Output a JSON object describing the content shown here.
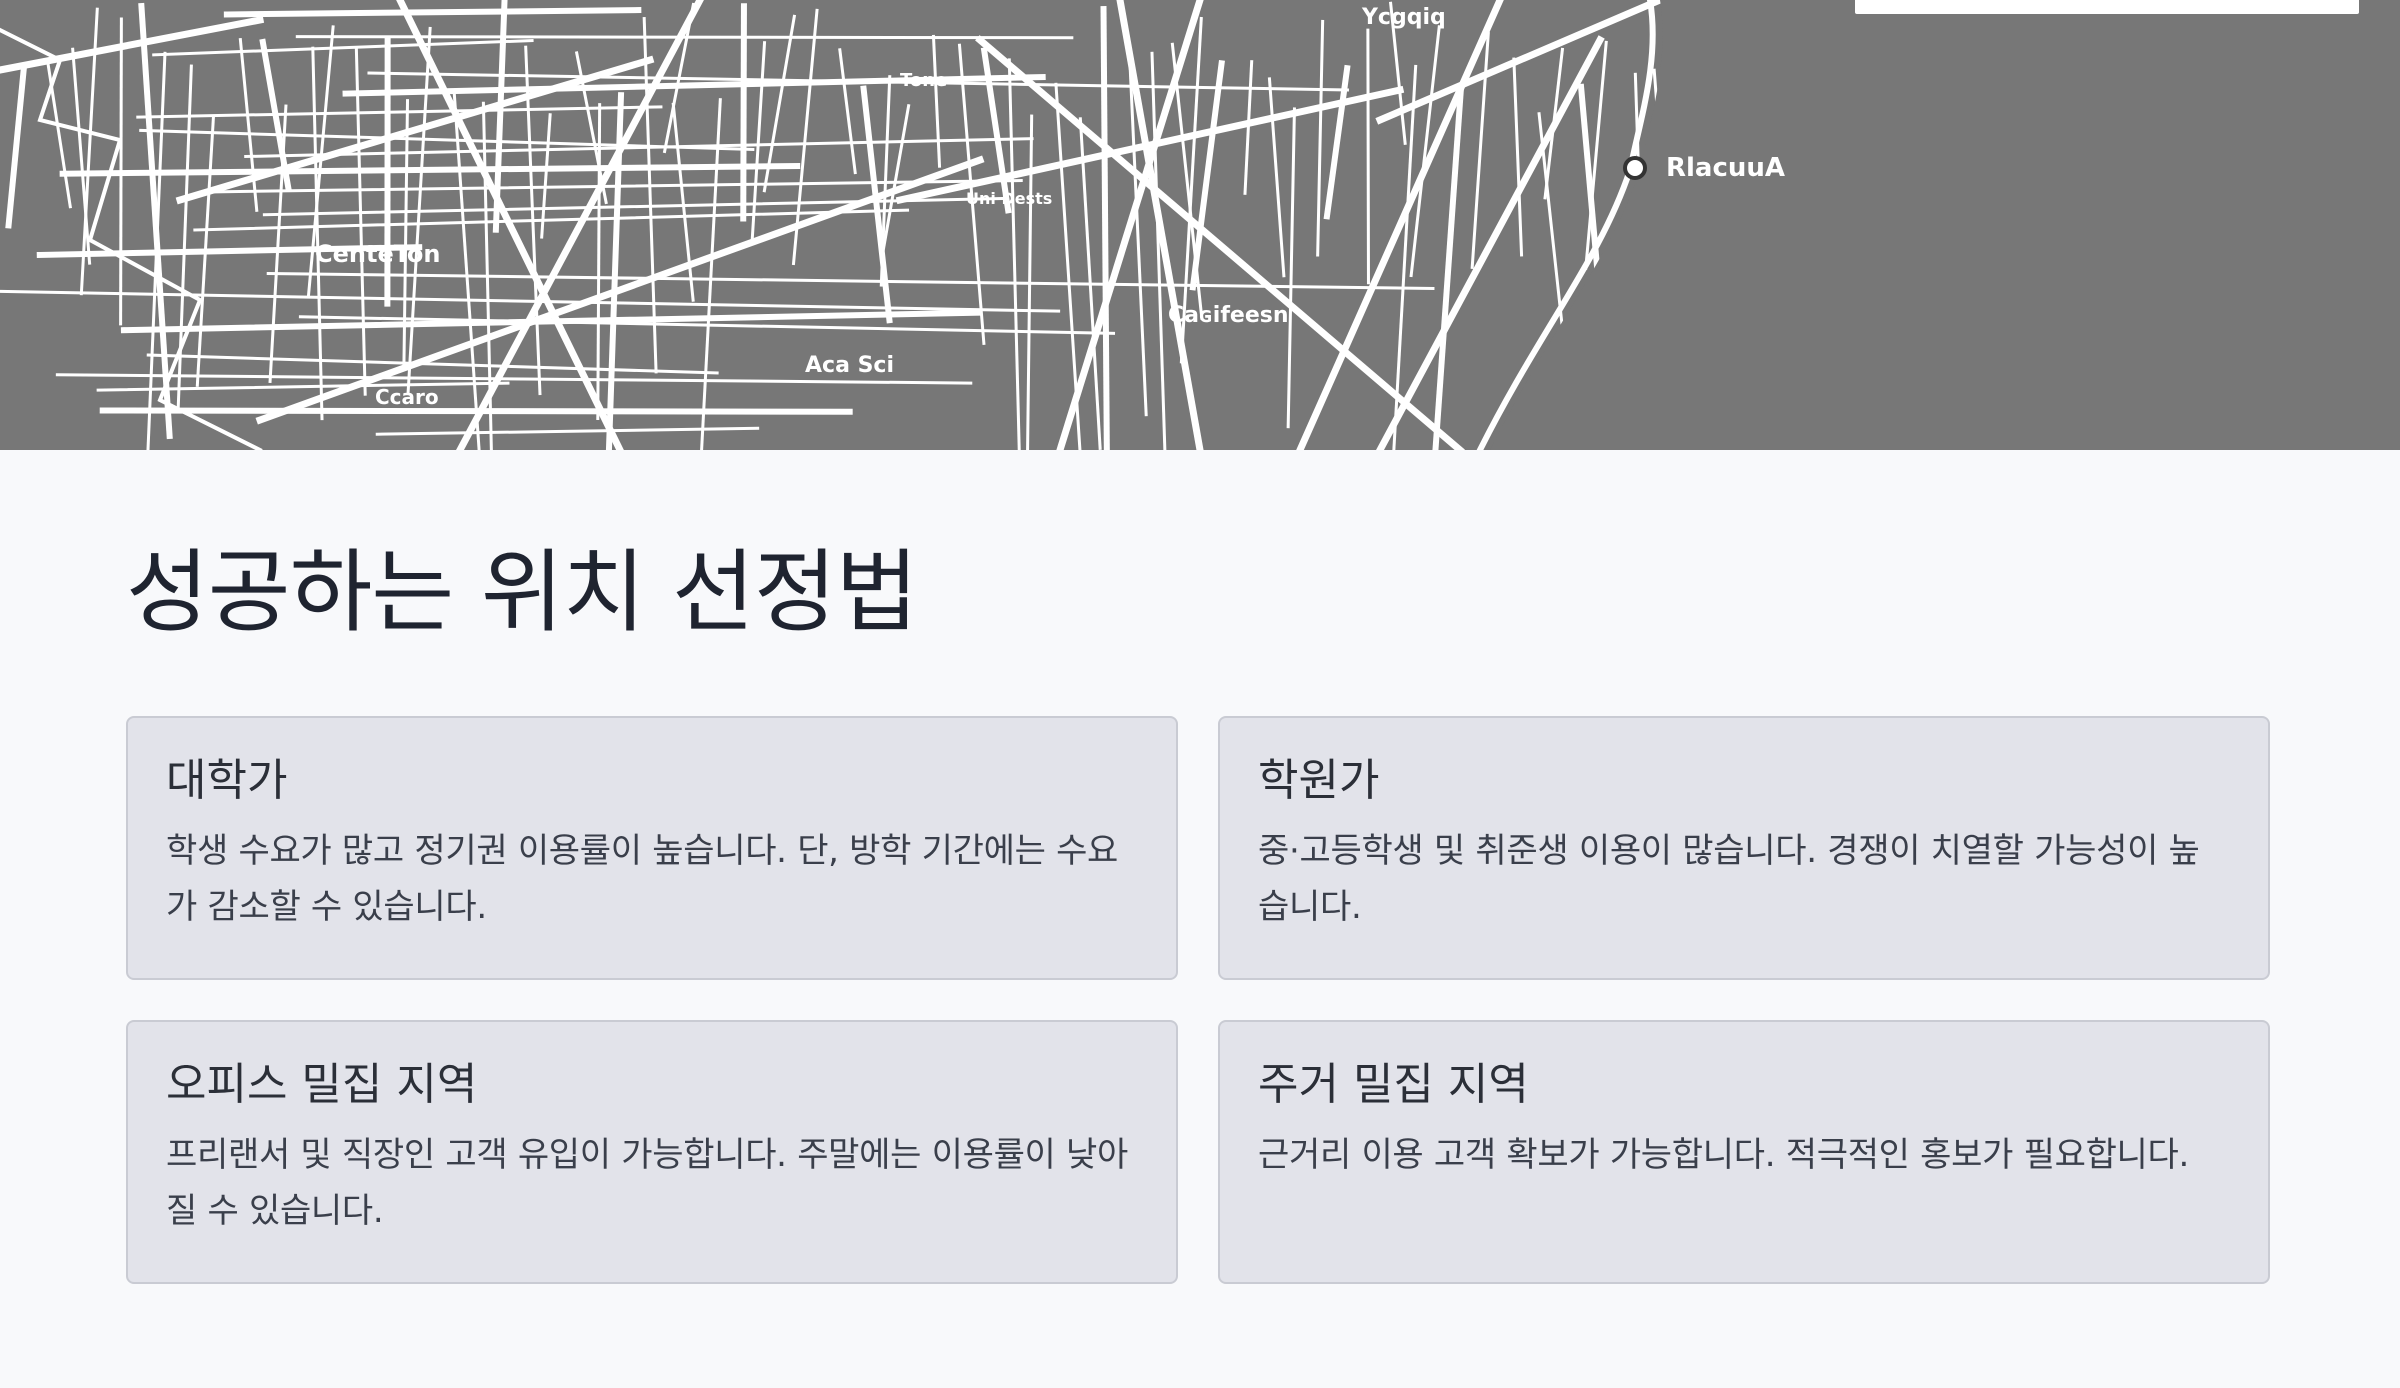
{
  "map": {
    "labels": [
      "Ycgqiq",
      "CenteTon",
      "Caɢifeesn",
      "RlacuuA",
      "Ccaro",
      "Aca Sci",
      "Uni Dests",
      "Tone"
    ]
  },
  "locations": {
    "title": "성공하는 위치 선정법",
    "cards": [
      {
        "title": "대학가",
        "description": "학생 수요가 많고 정기권 이용률이 높습니다. 단, 방학 기간에는 수요가 감소할 수 있습니다."
      },
      {
        "title": "학원가",
        "description": "중·고등학생 및 취준생 이용이 많습니다. 경쟁이 치열할 가능성이 높습니다."
      },
      {
        "title": "오피스 밀집 지역",
        "description": "프리랜서 및 직장인 고객 유입이 가능합니다. 주말에는 이용률이 낮아질 수 있습니다."
      },
      {
        "title": "주거 밀집 지역",
        "description": "근거리 이용 고객 확보가 가능합니다. 적극적인 홍보가 필요합니다."
      }
    ]
  }
}
